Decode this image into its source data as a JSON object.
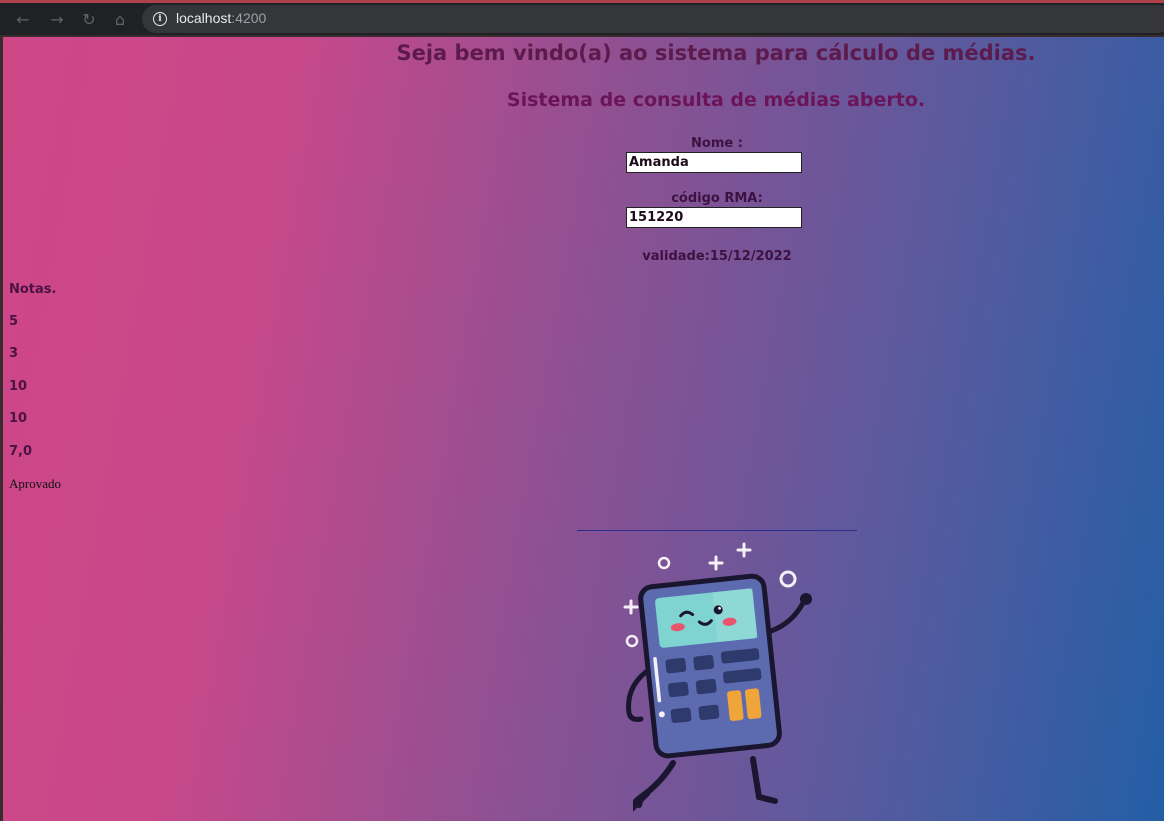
{
  "browser": {
    "url_host": "localhost",
    "url_port": ":4200"
  },
  "header": {
    "title": "Seja bem vindo(a) ao sistema para cálculo de médias.",
    "subtitle": "Sistema de consulta de médias aberto."
  },
  "form": {
    "name_label": "Nome :",
    "name_value": "Amanda",
    "code_label": "código RMA:",
    "code_value": "151220",
    "validity": "validade:15/12/2022"
  },
  "grades": {
    "heading": "Notas.",
    "values": [
      "5",
      "3",
      "10",
      "10"
    ],
    "average": "7,0",
    "status": "Aprovado"
  },
  "colors": {
    "gradient_left": "#cf4787",
    "gradient_right": "#235ea6",
    "title_color": "#5c1a4d"
  }
}
